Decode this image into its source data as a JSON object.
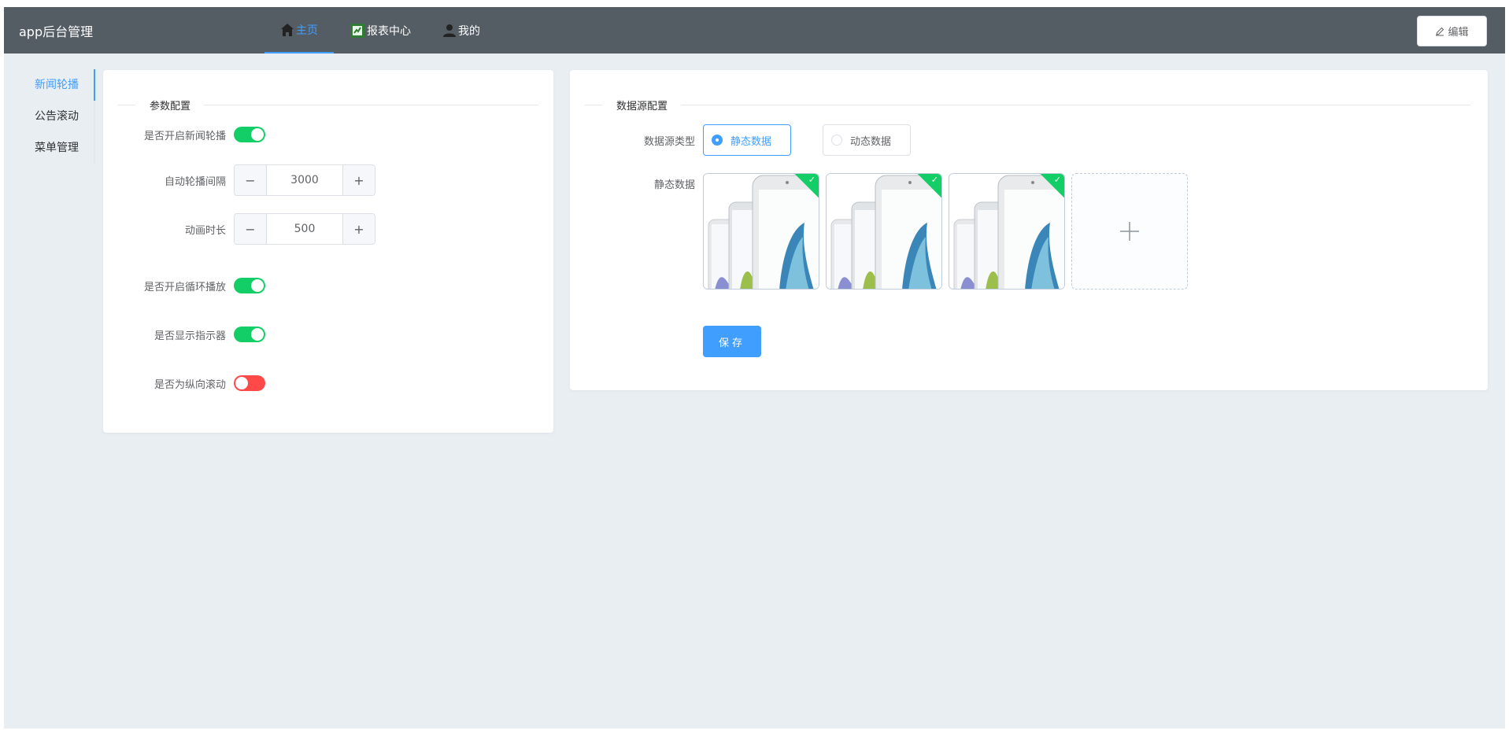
{
  "app": {
    "title": "app后台管理"
  },
  "nav": {
    "items": [
      {
        "label": "主页",
        "icon": "home-icon",
        "active": true
      },
      {
        "label": "报表中心",
        "icon": "report-icon",
        "active": false
      },
      {
        "label": "我的",
        "icon": "user-icon",
        "active": false
      }
    ]
  },
  "header": {
    "edit_label": "编辑",
    "edit_icon": "pencil-icon"
  },
  "sidebar": {
    "items": [
      {
        "label": "新闻轮播",
        "active": true
      },
      {
        "label": "公告滚动",
        "active": false
      },
      {
        "label": "菜单管理",
        "active": false
      }
    ]
  },
  "params": {
    "legend": "参数配置",
    "enable_carousel": {
      "label": "是否开启新闻轮播",
      "value": true
    },
    "interval": {
      "label": "自动轮播间隔",
      "value": "3000",
      "minus": "−",
      "plus": "+"
    },
    "duration": {
      "label": "动画时长",
      "value": "500",
      "minus": "−",
      "plus": "+"
    },
    "loop": {
      "label": "是否开启循环播放",
      "value": true
    },
    "indicator": {
      "label": "是否显示指示器",
      "value": true
    },
    "vertical": {
      "label": "是否为纵向滚动",
      "value": false
    }
  },
  "datasource": {
    "legend": "数据源配置",
    "type_label": "数据源类型",
    "options": [
      {
        "label": "静态数据",
        "checked": true
      },
      {
        "label": "动态数据",
        "checked": false
      }
    ],
    "static_label": "静态数据",
    "images": [
      {
        "alt": "phone-image",
        "uploaded": true
      },
      {
        "alt": "phone-image",
        "uploaded": true
      },
      {
        "alt": "phone-image",
        "uploaded": true
      }
    ],
    "upload_icon": "plus-icon",
    "save_label": "保存"
  },
  "colors": {
    "header_bg": "#545c64",
    "accent": "#409eff",
    "switch_on": "#13ce66",
    "switch_off": "#ff4949",
    "page_bg": "#e9eef3"
  }
}
